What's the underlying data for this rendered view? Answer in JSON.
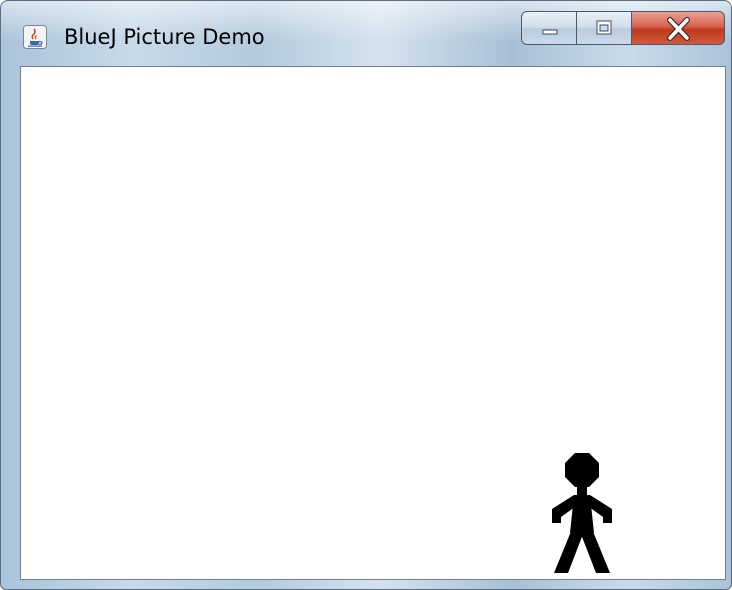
{
  "window": {
    "title": "BlueJ Picture Demo",
    "app_icon": "java-cup-icon",
    "caption_buttons": [
      "minimize-icon",
      "maximize-icon",
      "close-icon"
    ]
  },
  "canvas": {
    "background_color": "#ffffff",
    "figure": {
      "type": "stick-person",
      "color": "#000000"
    }
  }
}
